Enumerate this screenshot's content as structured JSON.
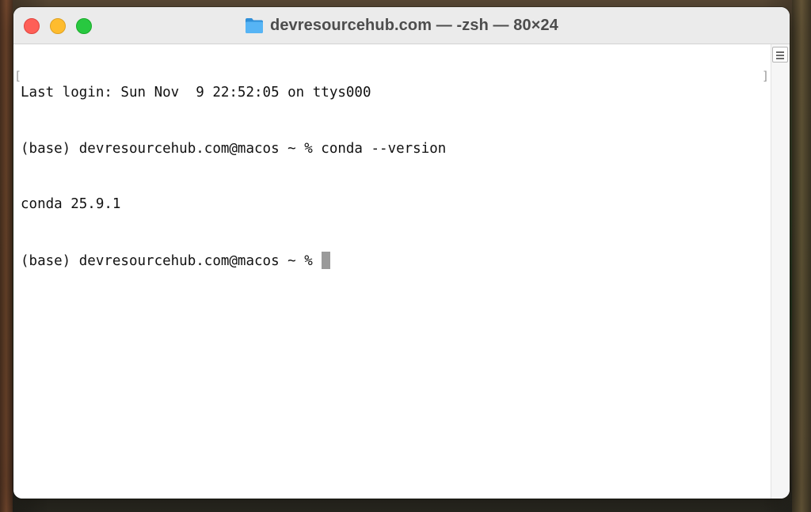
{
  "window": {
    "title": "devresourcehub.com — -zsh — 80×24",
    "title_icon": "folder-icon",
    "controls": {
      "close": "close-button",
      "minimize": "minimize-button",
      "zoom": "zoom-button"
    },
    "colors": {
      "close": "#fe5f57",
      "minimize": "#febc2e",
      "zoom": "#28c840",
      "folder": "#3aa0e8",
      "cursor": "#9a9a9a"
    }
  },
  "terminal": {
    "lines": [
      "Last login: Sun Nov  9 22:52:05 on ttys000",
      "(base) devresourcehub.com@macos ~ % conda --version",
      "conda 25.9.1",
      "(base) devresourcehub.com@macos ~ % "
    ],
    "mark_open": "[",
    "mark_close": "]",
    "cursor": "block"
  },
  "scrollbar": {
    "button_icon": "split-pane-icon"
  }
}
